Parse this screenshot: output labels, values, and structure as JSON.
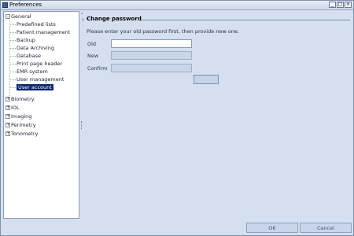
{
  "window": {
    "title": "Preferences"
  },
  "tree": {
    "items": [
      {
        "label": "General",
        "expanded": true,
        "children": [
          "Predefined lists",
          "Patient management",
          "Backup",
          "Data Archiving",
          "Database",
          "Print page header",
          "EMR system",
          "User management",
          "User account"
        ]
      },
      {
        "label": "Biometry"
      },
      {
        "label": "IOL"
      },
      {
        "label": "Imaging"
      },
      {
        "label": "Perimetry"
      },
      {
        "label": "Tonometry"
      }
    ],
    "selected": "User account"
  },
  "section": {
    "title": "Change password",
    "instructions": "Please enter your old password first, then provide new one.",
    "fields": {
      "old_label": "Old",
      "new_label": "New",
      "confirm_label": "Confirm"
    }
  },
  "buttons": {
    "ok": "OK",
    "cancel": "Cancel"
  },
  "colors": {
    "selection": "#0a246a",
    "background": "#d4dff0"
  }
}
